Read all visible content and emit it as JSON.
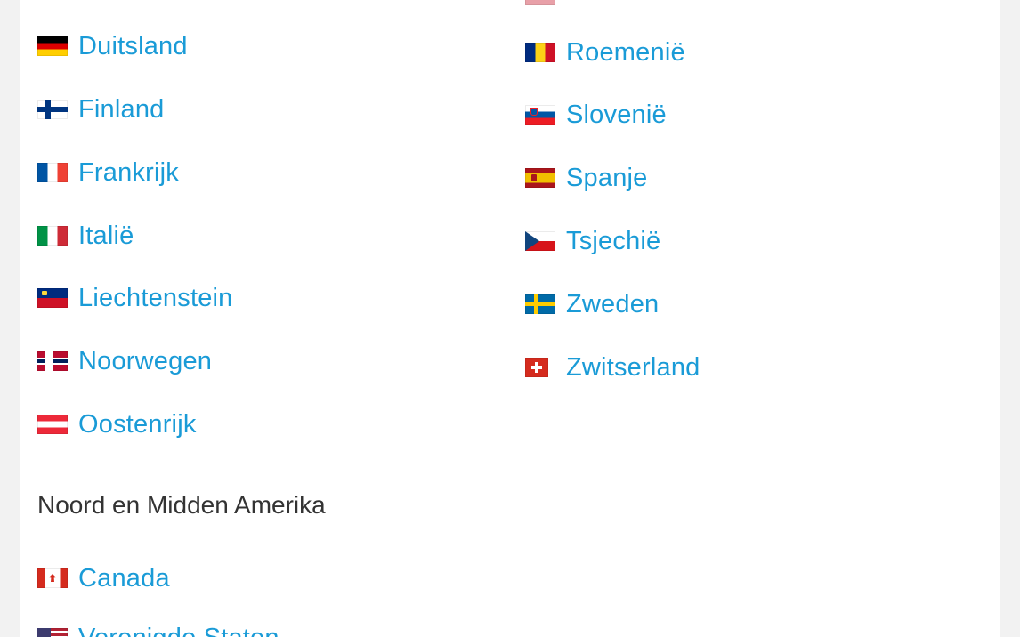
{
  "europe": {
    "left": [
      {
        "name": "Duitsland",
        "flag": "germany-flag-icon"
      },
      {
        "name": "Finland",
        "flag": "finland-flag-icon"
      },
      {
        "name": "Frankrijk",
        "flag": "france-flag-icon"
      },
      {
        "name": "Italië",
        "flag": "italy-flag-icon"
      },
      {
        "name": "Liechtenstein",
        "flag": "liechtenstein-flag-icon"
      },
      {
        "name": "Noorwegen",
        "flag": "norway-flag-icon"
      },
      {
        "name": "Oostenrijk",
        "flag": "austria-flag-icon"
      }
    ],
    "right": [
      {
        "name": "Roemenië",
        "flag": "romania-flag-icon"
      },
      {
        "name": "Slovenië",
        "flag": "slovenia-flag-icon"
      },
      {
        "name": "Spanje",
        "flag": "spain-flag-icon"
      },
      {
        "name": "Tsjechië",
        "flag": "czechia-flag-icon"
      },
      {
        "name": "Zweden",
        "flag": "sweden-flag-icon"
      },
      {
        "name": "Zwitserland",
        "flag": "switzerland-flag-icon"
      }
    ]
  },
  "north_central_america": {
    "heading": "Noord en Midden Amerika",
    "items": [
      {
        "name": "Canada",
        "flag": "canada-flag-icon"
      },
      {
        "name": "Verenigde Staten",
        "flag": "united-states-flag-icon"
      }
    ]
  },
  "colors": {
    "link": "#1a9bd7",
    "heading": "#333333",
    "panel": "#ffffff",
    "background": "#f2f2f2"
  }
}
